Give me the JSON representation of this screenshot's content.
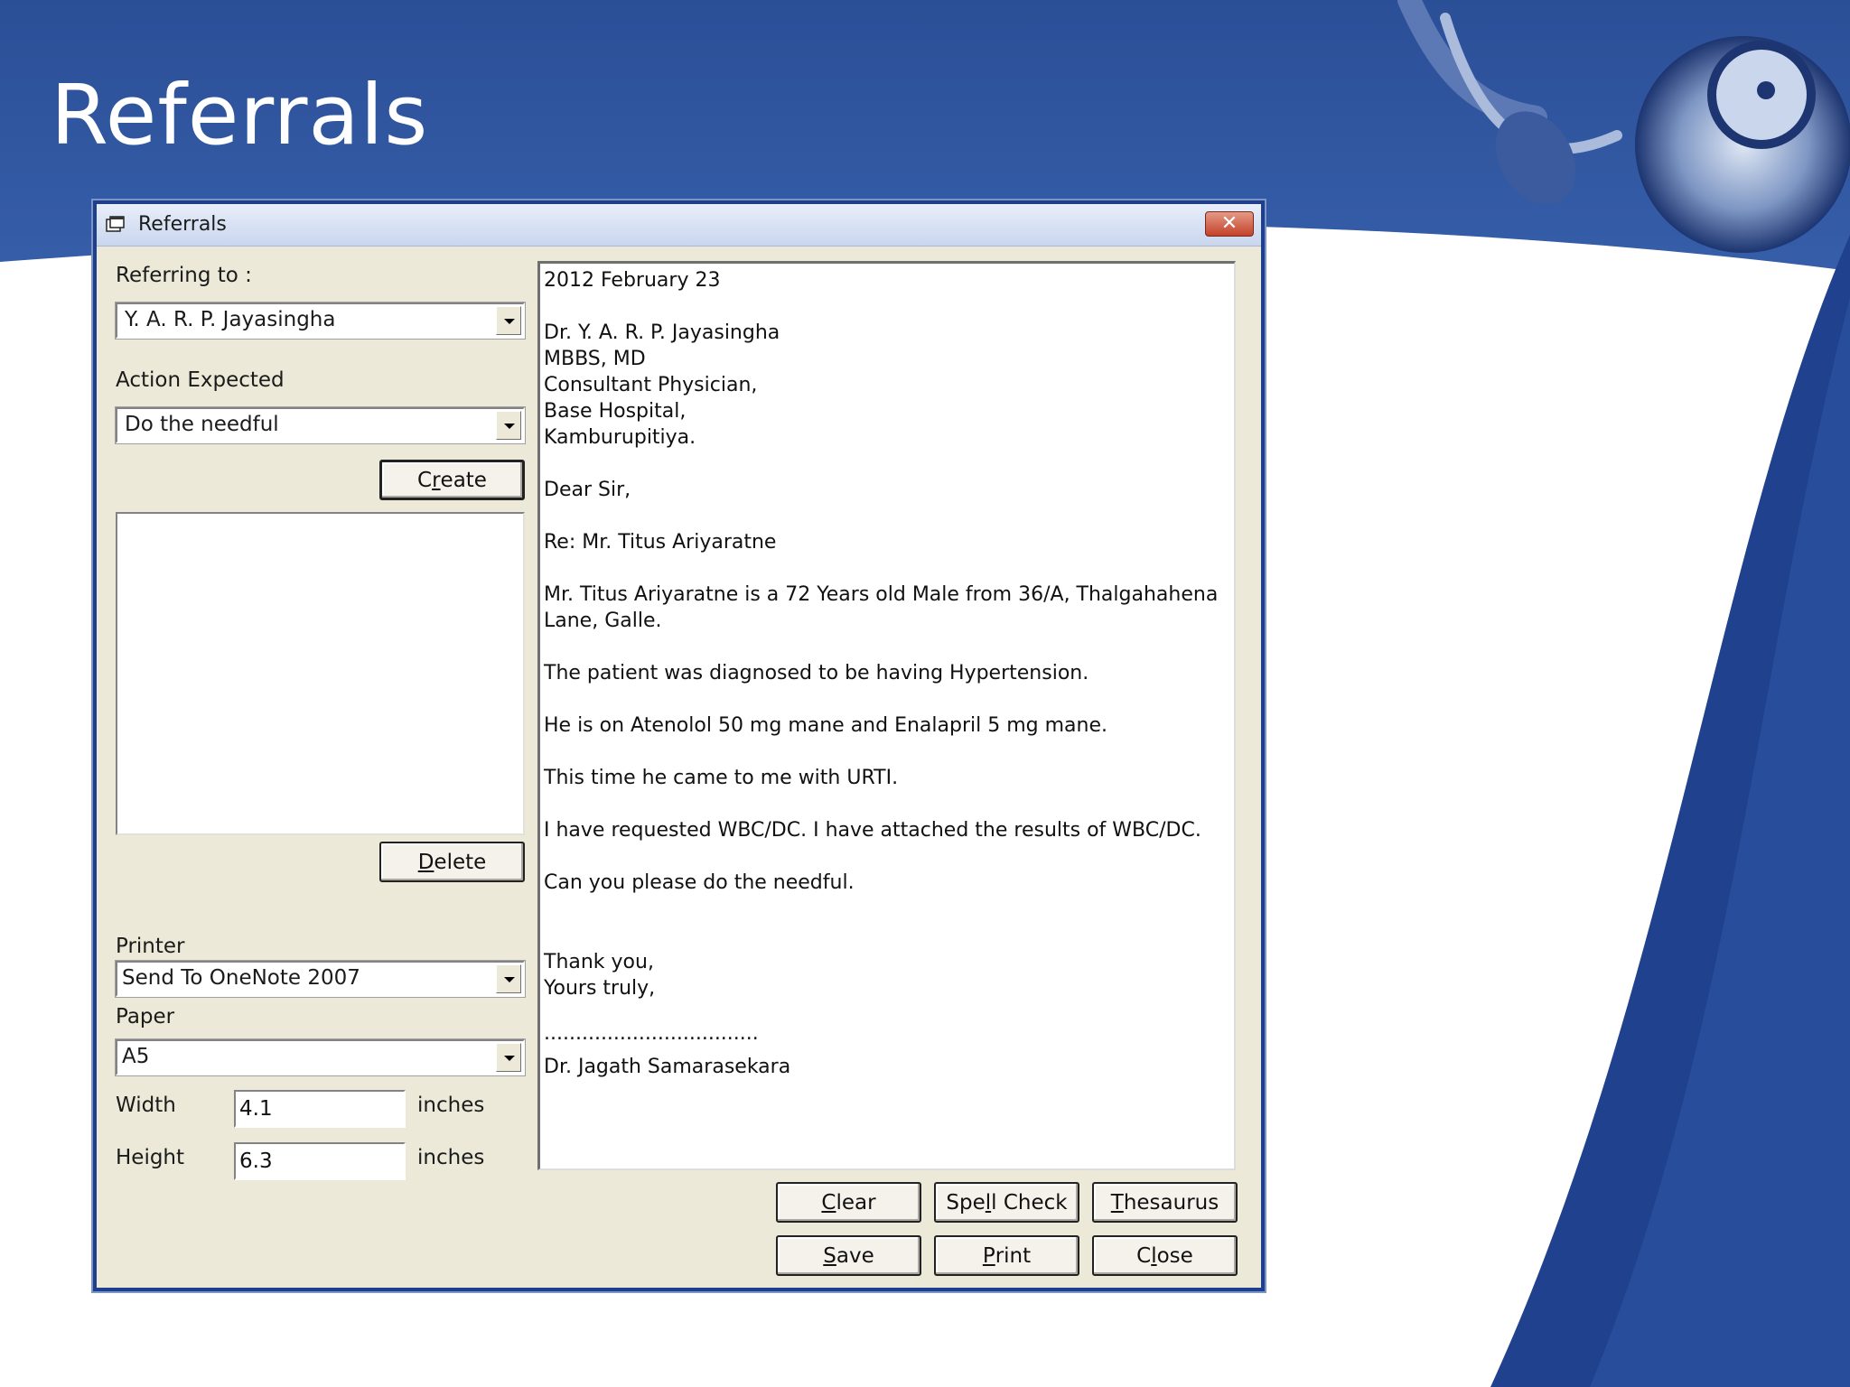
{
  "slide": {
    "title": "Referrals"
  },
  "window": {
    "title": "Referrals",
    "close_glyph": "✕"
  },
  "form": {
    "referring_to_label": "Referring to :",
    "referring_to_value": "Y. A. R. P. Jayasingha",
    "action_label": "Action Expected",
    "action_value": "Do the needful",
    "create_button": {
      "mnemonic": "r",
      "pre": "C",
      "post": "eate"
    },
    "delete_button": {
      "mnemonic": "D",
      "pre": "",
      "post": "elete"
    },
    "printer_label": "Printer",
    "printer_value": "Send To OneNote 2007",
    "paper_label": "Paper",
    "paper_value": "A5",
    "width_label": "Width",
    "width_value": "4.1",
    "height_label": "Height",
    "height_value": "6.3",
    "unit_label": "inches"
  },
  "letter": {
    "lines": [
      "2012 February 23",
      "Dr. Y. A. R. P. Jayasingha",
      "MBBS, MD",
      "Consultant Physician,",
      "Base Hospital,",
      "Kamburupitiya.",
      "Dear Sir,",
      "Re: Mr. Titus Ariyaratne",
      "Mr. Titus Ariyaratne is a 72 Years old Male from 36/A, Thalgahahena",
      "Lane, Galle.",
      "The patient was diagnosed to be having Hypertension.",
      "He is on Atenolol 50 mg mane and Enalapril 5 mg mane.",
      "This time he came to me with URTI.",
      "I have requested WBC/DC. I have attached the results of WBC/DC.",
      "Can you please do the needful.",
      "Thank you,",
      "Yours truly,",
      "..................................",
      "Dr. Jagath Samarasekara"
    ]
  },
  "buttons": {
    "clear": {
      "mnemonic": "C",
      "pre": "",
      "post": "lear"
    },
    "spell_check": {
      "mnemonic": "l",
      "pre": "Spe",
      "post": "l Check"
    },
    "thesaurus": {
      "mnemonic": "T",
      "pre": "",
      "post": "hesaurus"
    },
    "save": {
      "mnemonic": "S",
      "pre": "",
      "post": "ave"
    },
    "print": {
      "mnemonic": "P",
      "pre": "",
      "post": "rint"
    },
    "close": {
      "mnemonic": "l",
      "pre": "C",
      "post": "ose"
    }
  },
  "colors": {
    "slide_blue": "#2e5aa8",
    "slide_dark_blue": "#1f418e",
    "dialog_face": "#ece9d8"
  }
}
